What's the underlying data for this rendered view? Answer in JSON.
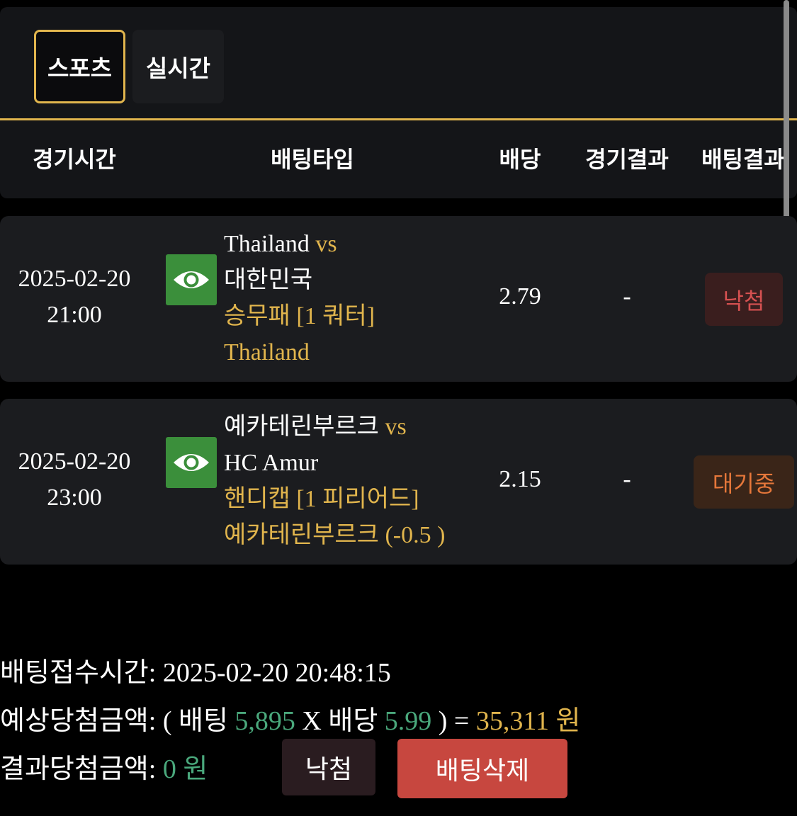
{
  "tabs": [
    {
      "label": "스포츠",
      "active": true
    },
    {
      "label": "실시간",
      "active": false
    }
  ],
  "table_headers": {
    "time": "경기시간",
    "bet_type": "배팅타입",
    "odds": "배당",
    "game_result": "경기결과",
    "bet_result": "배팅결과"
  },
  "rows": [
    {
      "date": "2025-02-20",
      "time": "21:00",
      "home": "Thailand",
      "vs": "vs",
      "away": "대한민국",
      "market": "승무패 [1 쿼터]",
      "pick": "Thailand",
      "odds": "2.79",
      "game_result": "-",
      "bet_result": "낙첨"
    },
    {
      "date": "2025-02-20",
      "time": "23:00",
      "home": "예카테린부르크",
      "vs": "vs",
      "away": "HC Amur",
      "market": "핸디캡 [1 피리어드]",
      "pick": "예카테린부르크 (-0.5 )",
      "odds": "2.15",
      "game_result": "-",
      "bet_result": "대기중"
    }
  ],
  "summary": {
    "bet_time_label": "배팅접수시간:",
    "bet_time_value": "2025-02-20 20:48:15",
    "expected_label": "예상당첨금액:",
    "open_paren": "(",
    "bet_word": "배팅",
    "bet_amount": "5,895",
    "times": "X",
    "odds_word": "배당",
    "total_odds": "5.99",
    "close_paren_eq": ") =",
    "expected_amount": "35,311",
    "won": "원",
    "result_label": "결과당첨금액:",
    "result_amount": "0",
    "result_won": "원"
  },
  "buttons": {
    "status": "낙첨",
    "delete": "배팅삭제"
  },
  "colors": {
    "accent_gold": "#e1b54d",
    "green": "#4aa87c",
    "lose_red": "#d65151",
    "pending_orange": "#e5773a",
    "delete_red": "#c7473f"
  },
  "icons": {
    "view": "eye-icon"
  }
}
